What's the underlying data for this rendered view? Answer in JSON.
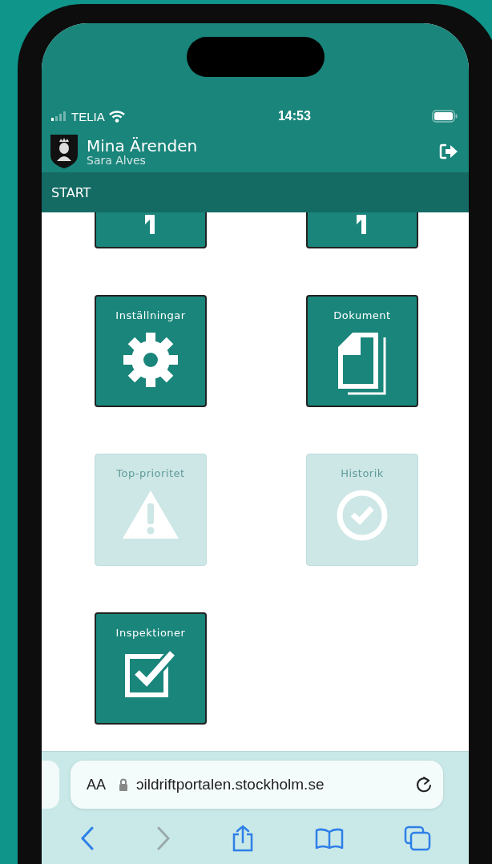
{
  "status_bar": {
    "carrier": "TELIA",
    "time": "14:53"
  },
  "header": {
    "title": "Mina Ärenden",
    "user": "Sara Alves"
  },
  "breadcrumb": "START",
  "tiles": [
    {
      "kind": "cut",
      "disabled": false
    },
    {
      "kind": "cut",
      "disabled": false
    },
    {
      "kind": "settings",
      "label": "Inställningar",
      "disabled": false
    },
    {
      "kind": "documents",
      "label": "Dokument",
      "disabled": false
    },
    {
      "kind": "priority",
      "label": "Top-prioritet",
      "disabled": true
    },
    {
      "kind": "history",
      "label": "Historik",
      "disabled": true
    },
    {
      "kind": "inspections",
      "label": "Inspektioner",
      "disabled": false
    }
  ],
  "browser": {
    "text_size": "AA",
    "url": "ɔildriftportalen.stockholm.se",
    "back_disabled": false,
    "forward_disabled": true
  }
}
